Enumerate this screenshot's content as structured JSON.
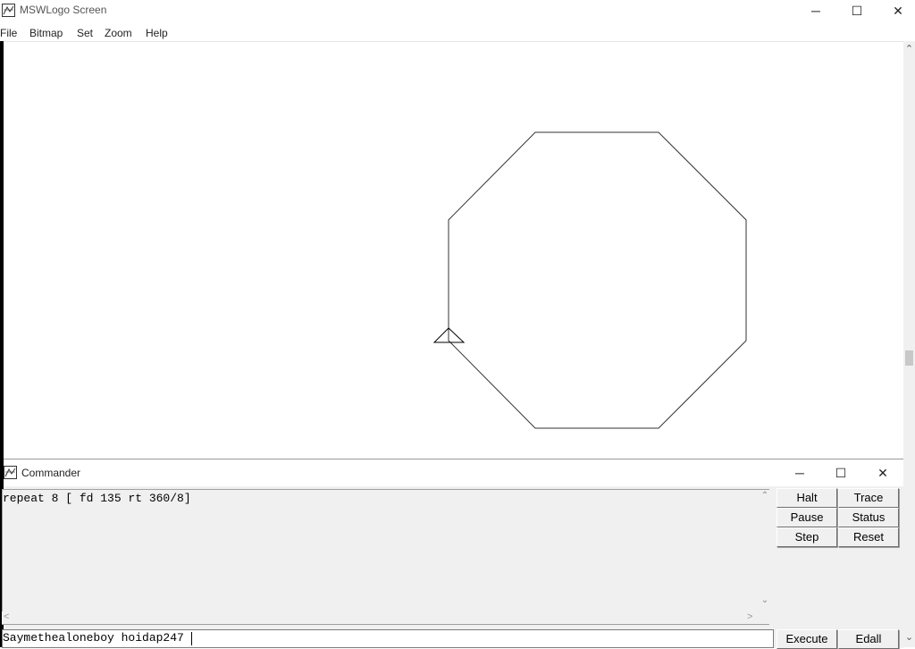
{
  "window": {
    "title": "MSWLogo Screen",
    "controls": {
      "minimize": "─",
      "maximize": "☐",
      "close": "✕"
    }
  },
  "menu": {
    "items": [
      "File",
      "Bitmap",
      "Set",
      "Zoom",
      "Help"
    ]
  },
  "canvas": {
    "shape": "octagon",
    "icons": [
      "turtle-icon"
    ]
  },
  "commander": {
    "title": "Commander",
    "controls": {
      "minimize": "─",
      "maximize": "☐",
      "close": "✕"
    },
    "history": [
      "repeat 8 [ fd 135 rt 360/8]"
    ],
    "input_value": "Saymethealoneboy hoidap247",
    "buttons": {
      "halt": "Halt",
      "trace": "Trace",
      "pause": "Pause",
      "status": "Status",
      "step": "Step",
      "reset": "Reset",
      "execute": "Execute",
      "edall": "Edall"
    }
  }
}
